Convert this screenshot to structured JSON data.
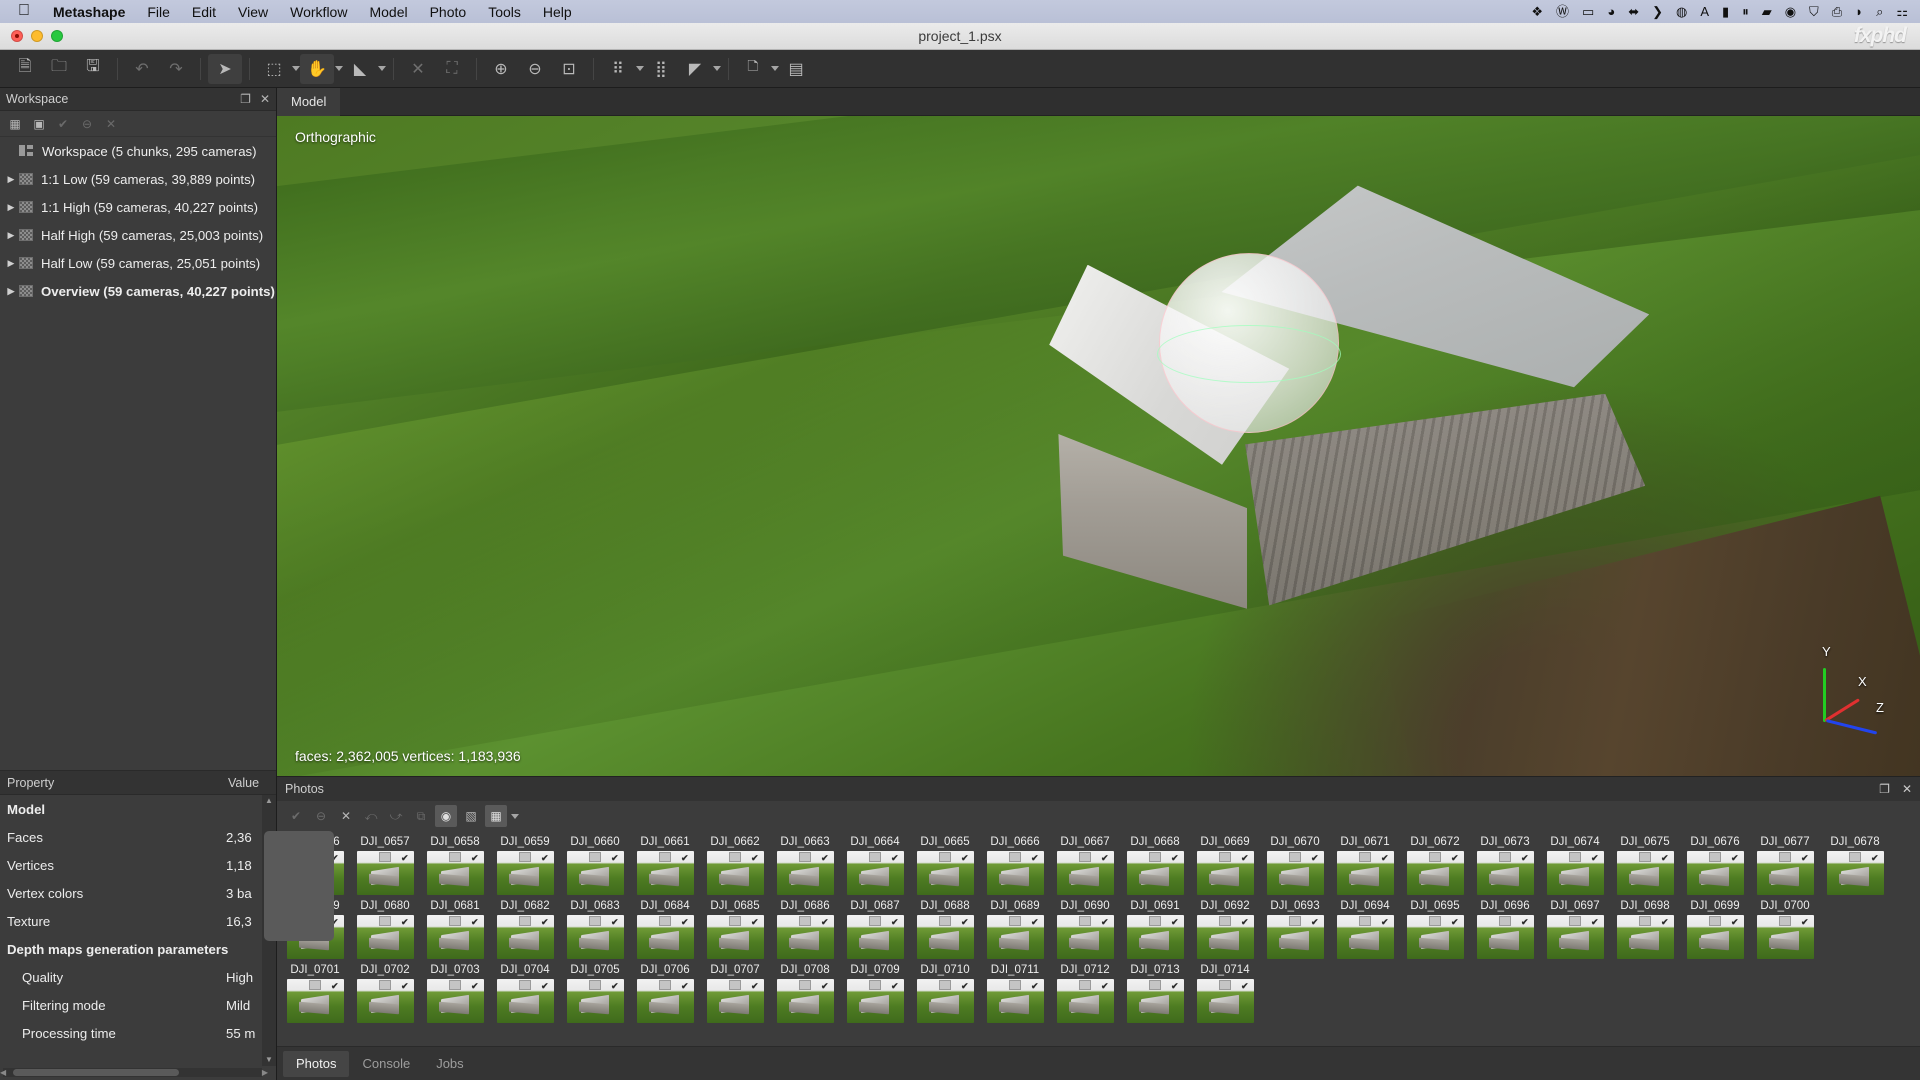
{
  "menubar": {
    "apple": "",
    "items": [
      {
        "label": "Metashape",
        "bold": true
      },
      {
        "label": "File",
        "bold": false
      },
      {
        "label": "Edit",
        "bold": false
      },
      {
        "label": "View",
        "bold": false
      },
      {
        "label": "Workflow",
        "bold": false
      },
      {
        "label": "Model",
        "bold": false
      },
      {
        "label": "Photo",
        "bold": false
      },
      {
        "label": "Tools",
        "bold": false
      },
      {
        "label": "Help",
        "bold": false
      }
    ],
    "tray": [
      {
        "name": "dropbox-icon",
        "glyph": "❖"
      },
      {
        "name": "wacom-icon",
        "glyph": "Ⓦ"
      },
      {
        "name": "display-icon",
        "glyph": "▭"
      },
      {
        "name": "cherry-record-icon",
        "glyph": "◕"
      },
      {
        "name": "arrows-icon",
        "glyph": "⬌"
      },
      {
        "name": "chevron-icon",
        "glyph": "❯"
      },
      {
        "name": "do-not-disturb-icon",
        "glyph": "◍"
      },
      {
        "name": "text-input-icon",
        "glyph": "A"
      },
      {
        "name": "briefcase-icon",
        "glyph": "▮"
      },
      {
        "name": "pause-icon",
        "glyph": "⏸"
      },
      {
        "name": "battery-icon",
        "glyph": "▰"
      },
      {
        "name": "time-machine-icon",
        "glyph": "◉"
      },
      {
        "name": "shield-icon",
        "glyph": "⛉"
      },
      {
        "name": "airplay-icon",
        "glyph": "⎙"
      },
      {
        "name": "wifi-icon",
        "glyph": "◗"
      },
      {
        "name": "search-icon",
        "glyph": "⌕"
      },
      {
        "name": "control-center-icon",
        "glyph": "⚏"
      }
    ]
  },
  "titlebar": {
    "title": "project_1.psx",
    "brand": "fxphd"
  },
  "toolbar": {
    "groups": [
      {
        "buttons": [
          {
            "name": "new-document-button",
            "glyph": "🗎",
            "state": "normal",
            "caret": false
          },
          {
            "name": "open-folder-button",
            "glyph": "🗀",
            "state": "normal",
            "caret": false
          },
          {
            "name": "save-button",
            "glyph": "🖫",
            "state": "normal",
            "caret": false
          }
        ]
      },
      {
        "buttons": [
          {
            "name": "undo-button",
            "glyph": "↶",
            "state": "dim",
            "caret": false
          },
          {
            "name": "redo-button",
            "glyph": "↷",
            "state": "dim",
            "caret": false
          }
        ]
      },
      {
        "buttons": [
          {
            "name": "select-arrow-tool",
            "glyph": "➤",
            "state": "active",
            "caret": false
          }
        ]
      },
      {
        "buttons": [
          {
            "name": "rectangle-selection-tool",
            "glyph": "⬚",
            "state": "normal",
            "caret": true
          },
          {
            "name": "pan-tool",
            "glyph": "✋",
            "state": "active",
            "caret": true
          },
          {
            "name": "rotate-object-tool",
            "glyph": "◣",
            "state": "normal",
            "caret": true
          }
        ]
      },
      {
        "buttons": [
          {
            "name": "delete-selection-button",
            "glyph": "✕",
            "state": "dim",
            "caret": false
          },
          {
            "name": "crop-selection-button",
            "glyph": "⛶",
            "state": "dim",
            "caret": false
          }
        ]
      },
      {
        "buttons": [
          {
            "name": "zoom-in-button",
            "glyph": "⊕",
            "state": "normal",
            "caret": false
          },
          {
            "name": "zoom-out-button",
            "glyph": "⊖",
            "state": "normal",
            "caret": false
          },
          {
            "name": "reset-view-button",
            "glyph": "⊡",
            "state": "normal",
            "caret": false
          }
        ]
      },
      {
        "buttons": [
          {
            "name": "point-cloud-view-button",
            "glyph": "⠿",
            "state": "normal",
            "caret": true
          },
          {
            "name": "dense-cloud-view-button",
            "glyph": "⣿",
            "state": "normal",
            "caret": false
          },
          {
            "name": "shaded-model-view-button",
            "glyph": "◤",
            "state": "normal",
            "caret": true
          }
        ]
      },
      {
        "buttons": [
          {
            "name": "camera-button",
            "glyph": "🗅",
            "state": "normal",
            "caret": true
          },
          {
            "name": "layers-button",
            "glyph": "▤",
            "state": "normal",
            "caret": false
          }
        ]
      }
    ]
  },
  "workspace": {
    "title": "Workspace",
    "panel_actions": [
      {
        "name": "undock-panel-icon",
        "glyph": "❐"
      },
      {
        "name": "close-panel-icon",
        "glyph": "✕"
      }
    ],
    "tools": [
      {
        "name": "add-chunk-icon",
        "glyph": "▦",
        "dim": false
      },
      {
        "name": "add-photos-icon",
        "glyph": "▣",
        "dim": false
      },
      {
        "name": "enable-icon",
        "glyph": "✔",
        "dim": true
      },
      {
        "name": "disable-icon",
        "glyph": "⊖",
        "dim": true
      },
      {
        "name": "remove-items-icon",
        "glyph": "✕",
        "dim": true
      }
    ],
    "tree": [
      {
        "label": "Workspace (5 chunks, 295 cameras)",
        "root": true,
        "arrow": false,
        "bold": false
      },
      {
        "label": "1:1 Low (59 cameras, 39,889 points)",
        "root": false,
        "arrow": true,
        "bold": false
      },
      {
        "label": "1:1 High (59 cameras, 40,227 points)",
        "root": false,
        "arrow": true,
        "bold": false
      },
      {
        "label": "Half High (59 cameras, 25,003 points)",
        "root": false,
        "arrow": true,
        "bold": false
      },
      {
        "label": "Half Low (59 cameras, 25,051 points)",
        "root": false,
        "arrow": true,
        "bold": false
      },
      {
        "label": "Overview (59 cameras, 40,227 points)",
        "root": false,
        "arrow": true,
        "bold": true
      }
    ]
  },
  "properties": {
    "col_property": "Property",
    "col_value": "Value",
    "rows": [
      {
        "name": "Model",
        "value": "",
        "section": true,
        "indent": false
      },
      {
        "name": "Faces",
        "value": "2,36",
        "section": false,
        "indent": false
      },
      {
        "name": "Vertices",
        "value": "1,18",
        "section": false,
        "indent": false
      },
      {
        "name": "Vertex colors",
        "value": "3 ba",
        "section": false,
        "indent": false
      },
      {
        "name": "Texture",
        "value": "16,3",
        "section": false,
        "indent": false
      },
      {
        "name": "Depth maps generation parameters",
        "value": "",
        "section": true,
        "indent": false
      },
      {
        "name": "Quality",
        "value": "High",
        "section": false,
        "indent": true
      },
      {
        "name": "Filtering mode",
        "value": "Mild",
        "section": false,
        "indent": true
      },
      {
        "name": "Processing time",
        "value": "55 m",
        "section": false,
        "indent": true
      }
    ]
  },
  "model_view": {
    "tab_label": "Model",
    "projection_label": "Orthographic",
    "stats": "faces: 2,362,005 vertices: 1,183,936",
    "gizmo": {
      "x_label": "X",
      "y_label": "Y",
      "z_label": "Z",
      "x_color": "#e03030",
      "y_color": "#22cc22",
      "z_color": "#2244ee"
    }
  },
  "photos_panel": {
    "title": "Photos",
    "panel_actions": [
      {
        "name": "undock-panel-icon",
        "glyph": "❐"
      },
      {
        "name": "close-panel-icon",
        "glyph": "✕"
      }
    ],
    "tools": [
      {
        "name": "enable-cameras-icon",
        "glyph": "✔",
        "style": "dim"
      },
      {
        "name": "disable-cameras-icon",
        "glyph": "⊖",
        "style": "dim"
      },
      {
        "name": "remove-cameras-icon",
        "glyph": "✕",
        "style": "normal"
      },
      {
        "name": "rotate-left-icon",
        "glyph": "⤺",
        "style": "dim"
      },
      {
        "name": "rotate-right-icon",
        "glyph": "⤻",
        "style": "dim"
      },
      {
        "name": "compare-icon",
        "glyph": "⧉",
        "style": "dim"
      },
      {
        "name": "show-masks-icon",
        "glyph": "◉",
        "style": "boxed"
      },
      {
        "name": "show-cameras-icon",
        "glyph": "▧",
        "style": "normal"
      },
      {
        "name": "thumbnail-size-icon",
        "glyph": "▦",
        "style": "boxed"
      }
    ],
    "rows": [
      [
        "DJI_0656",
        "DJI_0657",
        "DJI_0658",
        "DJI_0659",
        "DJI_0660",
        "DJI_0661",
        "DJI_0662",
        "DJI_0663",
        "DJI_0664",
        "DJI_0665",
        "DJI_0666",
        "DJI_0667",
        "DJI_0668",
        "DJI_0669",
        "DJI_0670",
        "DJI_0671",
        "DJI_0672",
        "DJI_0673",
        "DJI_0674",
        "DJI_0675",
        "DJI_0676",
        "DJI_0677",
        "DJI_0678"
      ],
      [
        "DJI_0679",
        "DJI_0680",
        "DJI_0681",
        "DJI_0682",
        "DJI_0683",
        "DJI_0684",
        "DJI_0685",
        "DJI_0686",
        "DJI_0687",
        "DJI_0688",
        "DJI_0689",
        "DJI_0690",
        "DJI_0691",
        "DJI_0692",
        "DJI_0693",
        "DJI_0694",
        "DJI_0695",
        "DJI_0696",
        "DJI_0697",
        "DJI_0698",
        "DJI_0699",
        "DJI_0700"
      ],
      [
        "DJI_0701",
        "DJI_0702",
        "DJI_0703",
        "DJI_0704",
        "DJI_0705",
        "DJI_0706",
        "DJI_0707",
        "DJI_0708",
        "DJI_0709",
        "DJI_0710",
        "DJI_0711",
        "DJI_0712",
        "DJI_0713",
        "DJI_0714"
      ]
    ],
    "bottom_tabs": [
      {
        "label": "Photos",
        "selected": true
      },
      {
        "label": "Console",
        "selected": false
      },
      {
        "label": "Jobs",
        "selected": false
      }
    ]
  }
}
